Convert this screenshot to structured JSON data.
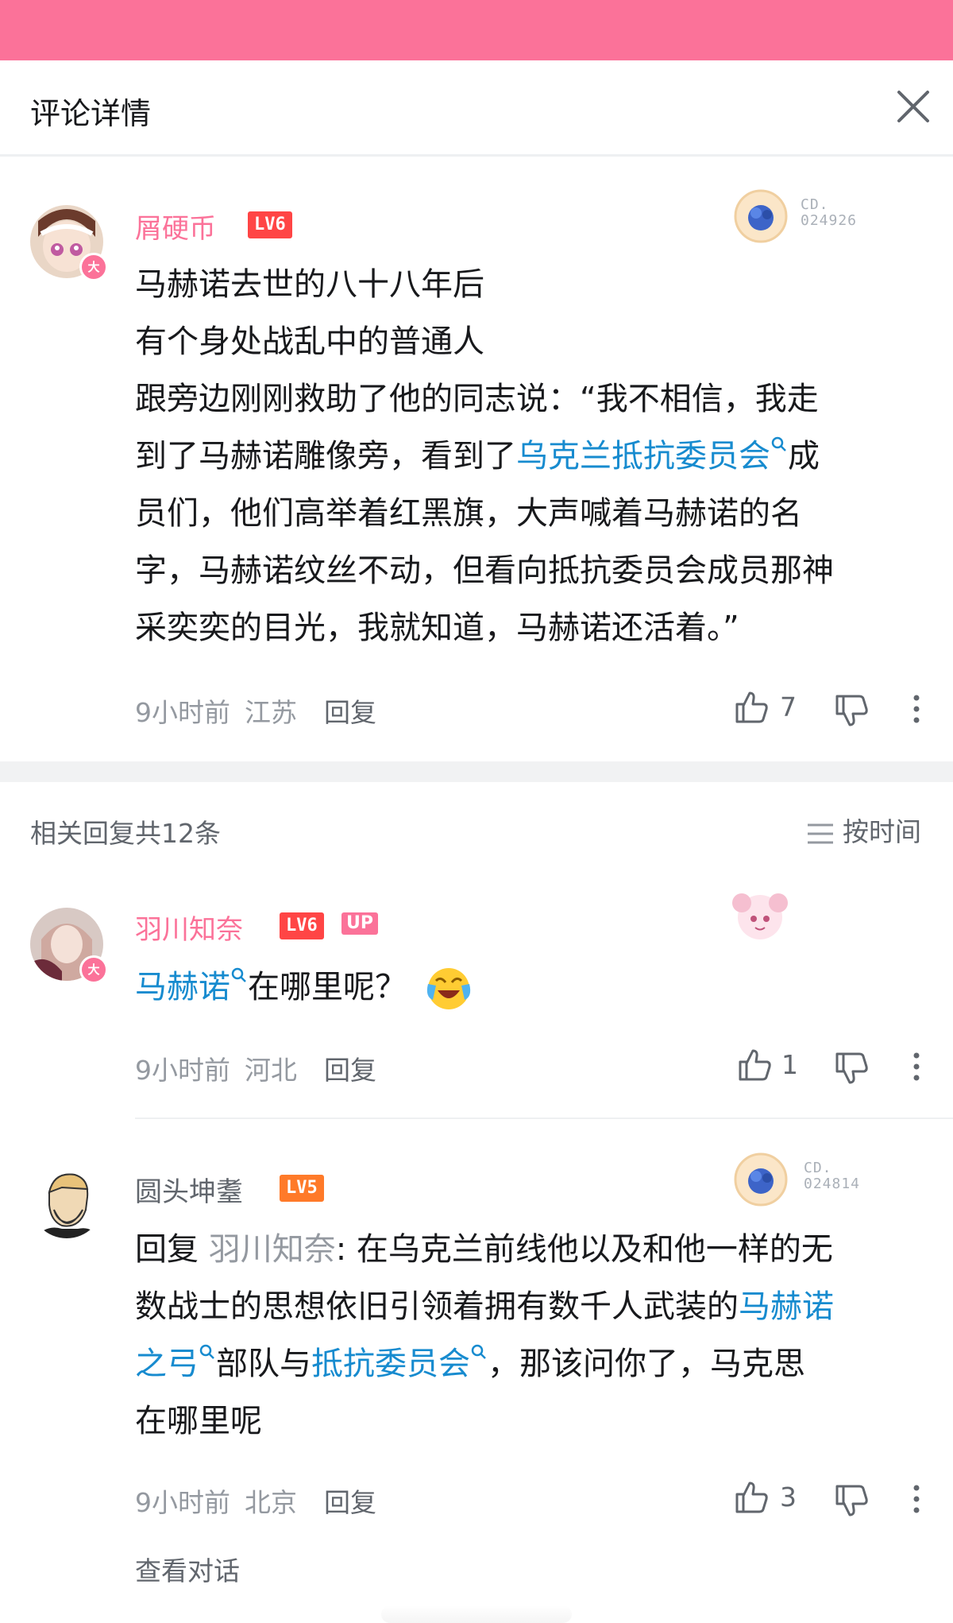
{
  "header": {
    "title": "评论详情"
  },
  "main_comment": {
    "username": "屑硬币",
    "level": "LV6",
    "fan_badge": "大",
    "decor_number": "CD.\n024926",
    "lines": [
      "马赫诺去世的八十八年后",
      "有个身处战乱中的普通人",
      "跟旁边刚刚救助了他的同志说：“我不相信，我走",
      "到了马赫诺雕像旁，看到了",
      "乌克兰抵抗委员会",
      "成",
      "员们，他们高举着红黑旗，大声喊着马赫诺的名",
      "字，马赫诺纹丝不动，但看向抵抗委员会成员那神",
      "采奕奕的目光，我就知道，马赫诺还活着。”"
    ],
    "time": "9小时前",
    "location": "江苏",
    "reply_label": "回复",
    "likes": "7"
  },
  "replies_header": {
    "title": "相关回复共12条",
    "sort_label": "按时间"
  },
  "reply1": {
    "username": "羽川知奈",
    "level": "LV6",
    "up_badge": "UP",
    "fan_badge": "大",
    "link_text": "马赫诺",
    "text": "在哪里呢？",
    "time": "9小时前",
    "location": "河北",
    "reply_label": "回复",
    "likes": "1"
  },
  "reply2": {
    "username": "圆头坤耋",
    "level": "LV5",
    "decor_number": "CD.\n024814",
    "reply_prefix": "回复 ",
    "reply_to": "羽川知奈",
    "line1": ": 在乌克兰前线他以及和他一样的无",
    "line2a": "数战士的思想依旧引领着拥有数千人武装的",
    "link1a": "马赫诺",
    "link1b": "之弓",
    "mid": "部队与",
    "link2": "抵抗委员会",
    "line3b": "，那该问你了，马克思",
    "line4": "在哪里呢",
    "time": "9小时前",
    "location": "北京",
    "reply_label": "回复",
    "likes": "3"
  },
  "view_conversation": "查看对话",
  "colors": {
    "brand_pink": "#fb7299",
    "link_blue": "#178bcf",
    "grey_text": "#9499a0"
  }
}
